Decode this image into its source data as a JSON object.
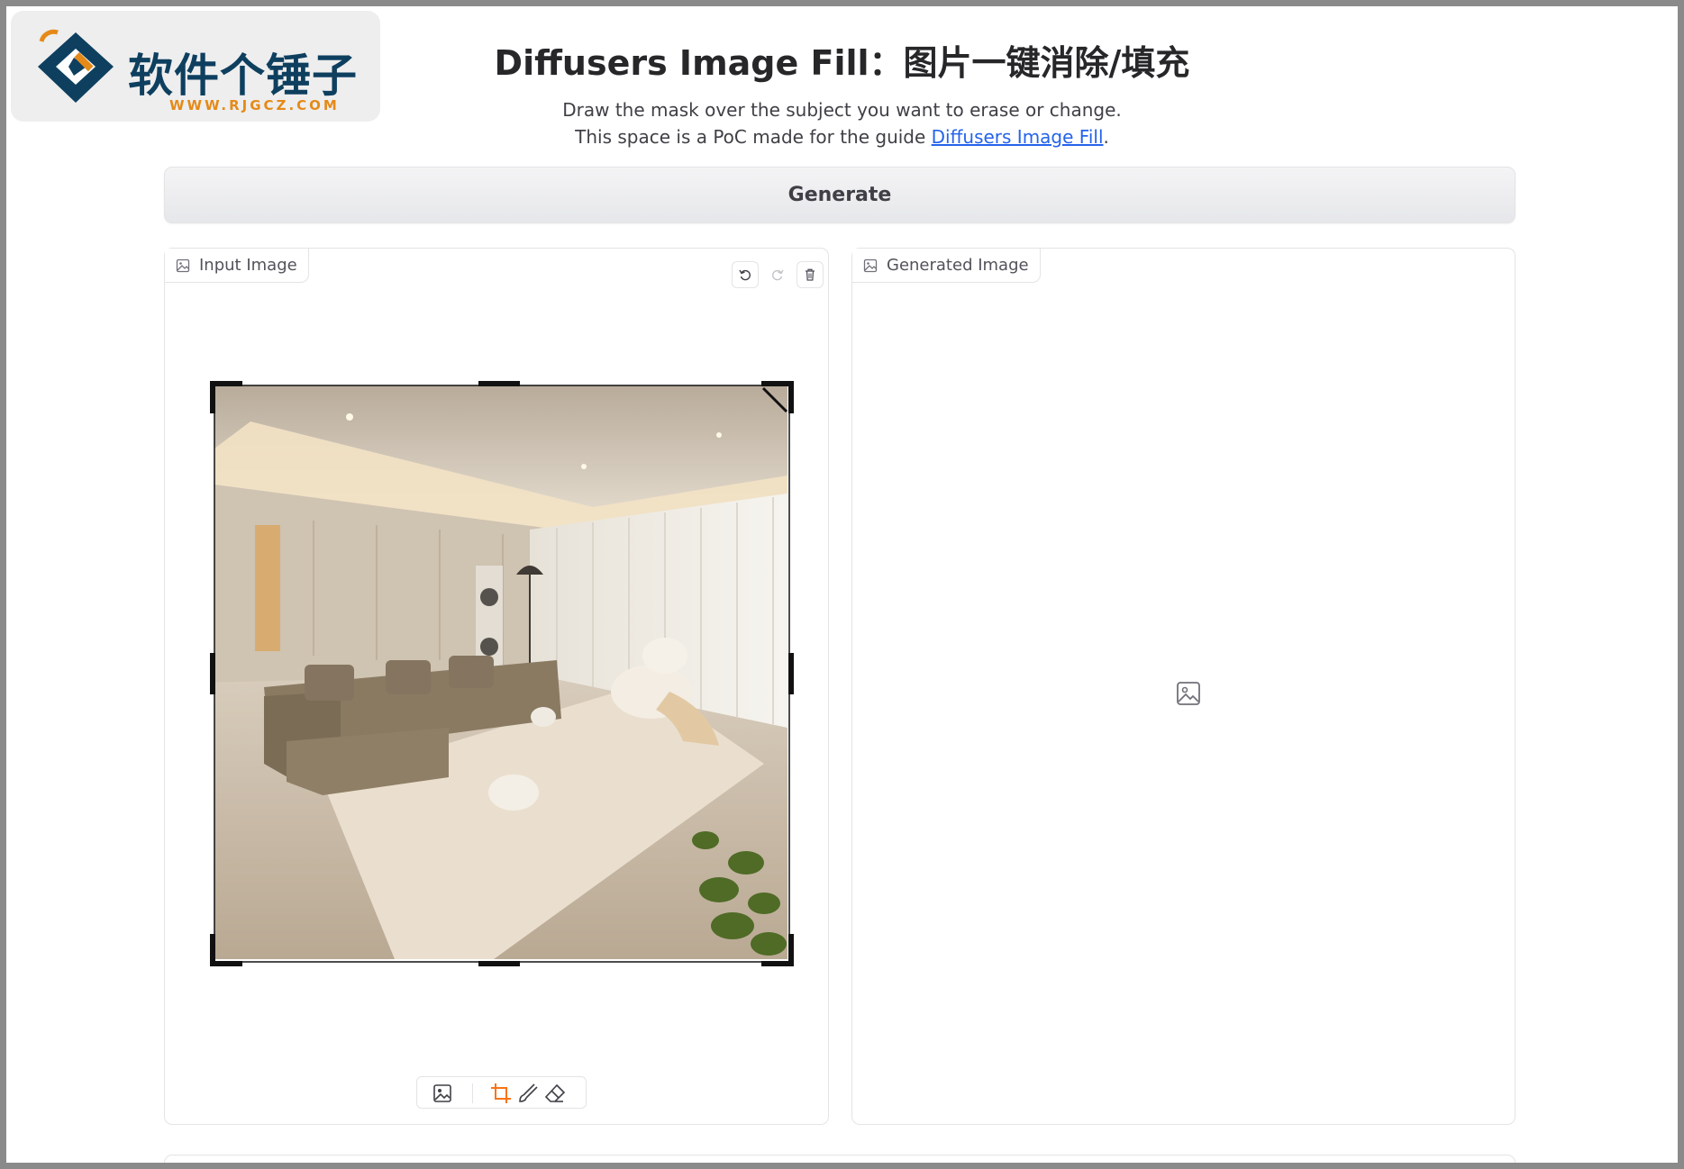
{
  "watermark": {
    "brand": "软件个锤子",
    "url": "WWW.RJGCZ.COM"
  },
  "header": {
    "title": "Diffusers Image Fill：图片一键消除/填充",
    "subtitle_line1": "Draw the mask over the subject you want to erase or change.",
    "subtitle_line2_prefix": "This space is a PoC made for the guide ",
    "subtitle_link": "Diffusers Image Fill",
    "subtitle_line2_suffix": "."
  },
  "actions": {
    "generate_label": "Generate"
  },
  "input_panel": {
    "label": "Input Image",
    "icon": "image-icon",
    "tools": [
      "undo-icon",
      "redo-icon",
      "trash-icon"
    ],
    "bottom_tools": [
      "image-icon",
      "crop-icon",
      "brush-icon",
      "eraser-icon"
    ],
    "active_tool": "crop"
  },
  "output_panel": {
    "label": "Generated Image",
    "icon": "image-icon",
    "empty_icon": "image-placeholder-icon"
  },
  "colors": {
    "accent": "#f97316",
    "link": "#2563eb",
    "border": "#e4e4e7",
    "button_bg": "#eeeff1",
    "brand_dark": "#0e3f5f",
    "brand_orange": "#e58a18"
  }
}
